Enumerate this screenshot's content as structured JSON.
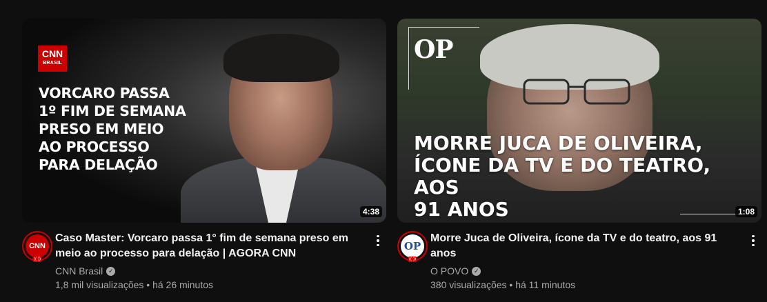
{
  "videos": [
    {
      "thumbnail": {
        "logo_text": "CNN",
        "logo_sub": "BRASIL",
        "headline": "VORCARO PASSA\n1º FIM DE SEMANA\nPRESO EM MEIO\nAO PROCESSO\nPARA DELAÇÃO",
        "duration": "4:38"
      },
      "avatar_text": "CNN",
      "title": "Caso Master: Vorcaro passa 1° fim de semana preso em meio ao processo para delação | AGORA CNN",
      "channel": "CNN Brasil",
      "verified": true,
      "views": "1,8 mil visualizações",
      "age": "há 26 minutos",
      "stats_sep": " • ",
      "menu_icon": "more-vert-icon"
    },
    {
      "thumbnail": {
        "logo_text": "OP",
        "headline": "MORRE JUCA DE OLIVEIRA,\nÍCONE DA TV E DO TEATRO, AOS\n91 ANOS",
        "duration": "1:08"
      },
      "avatar_text": "OP",
      "title": "Morre Juca de Oliveira, ícone da TV e do teatro, aos 91 anos",
      "channel": "O POVO",
      "verified": true,
      "views": "380 visualizações",
      "age": "há 11 minutos",
      "stats_sep": " • ",
      "menu_icon": "more-vert-icon"
    }
  ],
  "colors": {
    "background": "#0f0f0f",
    "cnn_red": "#cc0000",
    "text_primary": "#f1f1f1",
    "text_secondary": "#aaaaaa"
  }
}
